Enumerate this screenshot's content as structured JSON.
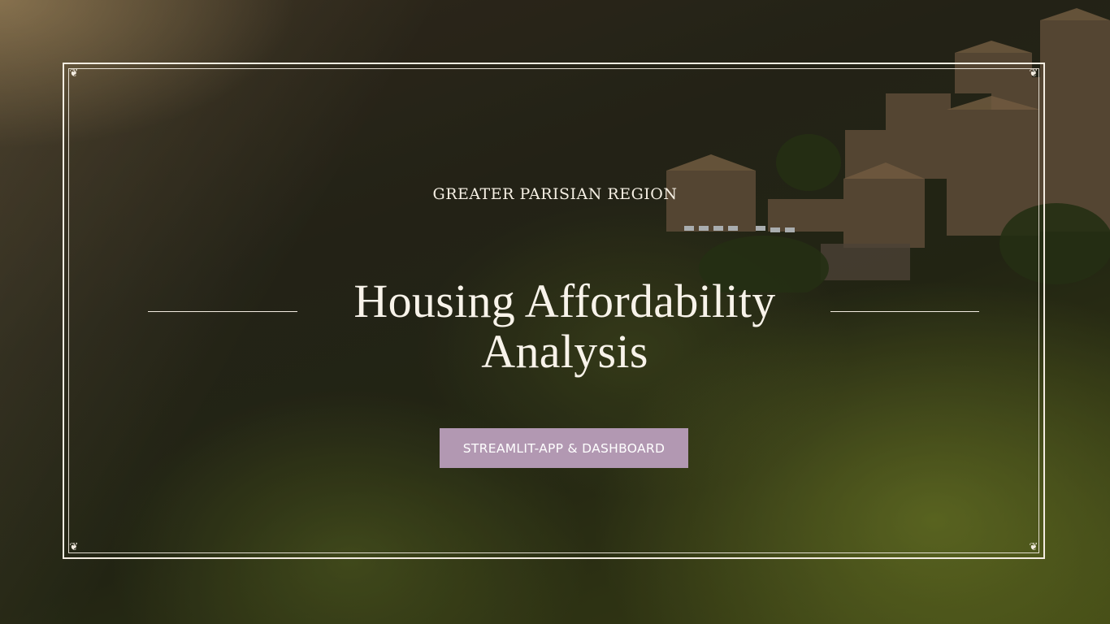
{
  "slide": {
    "subtitle": "GREATER PARISIAN REGION",
    "title_line1": "Housing Affordability",
    "title_line2": "Analysis",
    "badge_label": "STREAMLIT-APP & DASHBOARD"
  },
  "colors": {
    "frame": "#f3ece1",
    "badge_background": "#b298b2",
    "text": "#f8f3ea"
  }
}
